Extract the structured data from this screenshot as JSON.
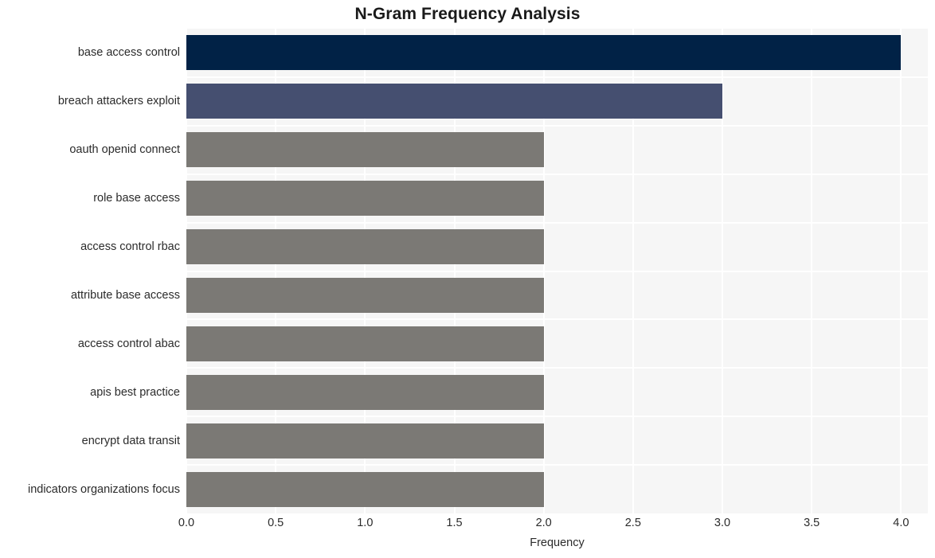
{
  "chart_data": {
    "type": "bar",
    "orientation": "horizontal",
    "title": "N-Gram Frequency Analysis",
    "xlabel": "Frequency",
    "ylabel": "",
    "xlim": [
      0,
      4.15
    ],
    "grid": true,
    "legend": "none",
    "categories": [
      "base access control",
      "breach attackers exploit",
      "oauth openid connect",
      "role base access",
      "access control rbac",
      "attribute base access",
      "access control abac",
      "apis best practice",
      "encrypt data transit",
      "indicators organizations focus"
    ],
    "values": [
      4,
      3,
      2,
      2,
      2,
      2,
      2,
      2,
      2,
      2
    ],
    "bar_colors": [
      "#012246",
      "#454f70",
      "#7b7975",
      "#7b7975",
      "#7b7975",
      "#7b7975",
      "#7b7975",
      "#7b7975",
      "#7b7975",
      "#7b7975"
    ],
    "xticks": [
      0,
      0.5,
      1,
      1.5,
      2,
      2.5,
      3,
      3.5,
      4
    ],
    "xtick_labels": [
      "0.0",
      "0.5",
      "1.0",
      "1.5",
      "2.0",
      "2.5",
      "3.0",
      "3.5",
      "4.0"
    ],
    "plot_background": "#f6f6f6",
    "gridline_color": "#ffffff",
    "figure_background": "#ffffff",
    "text_color": "#2b2b2b"
  }
}
